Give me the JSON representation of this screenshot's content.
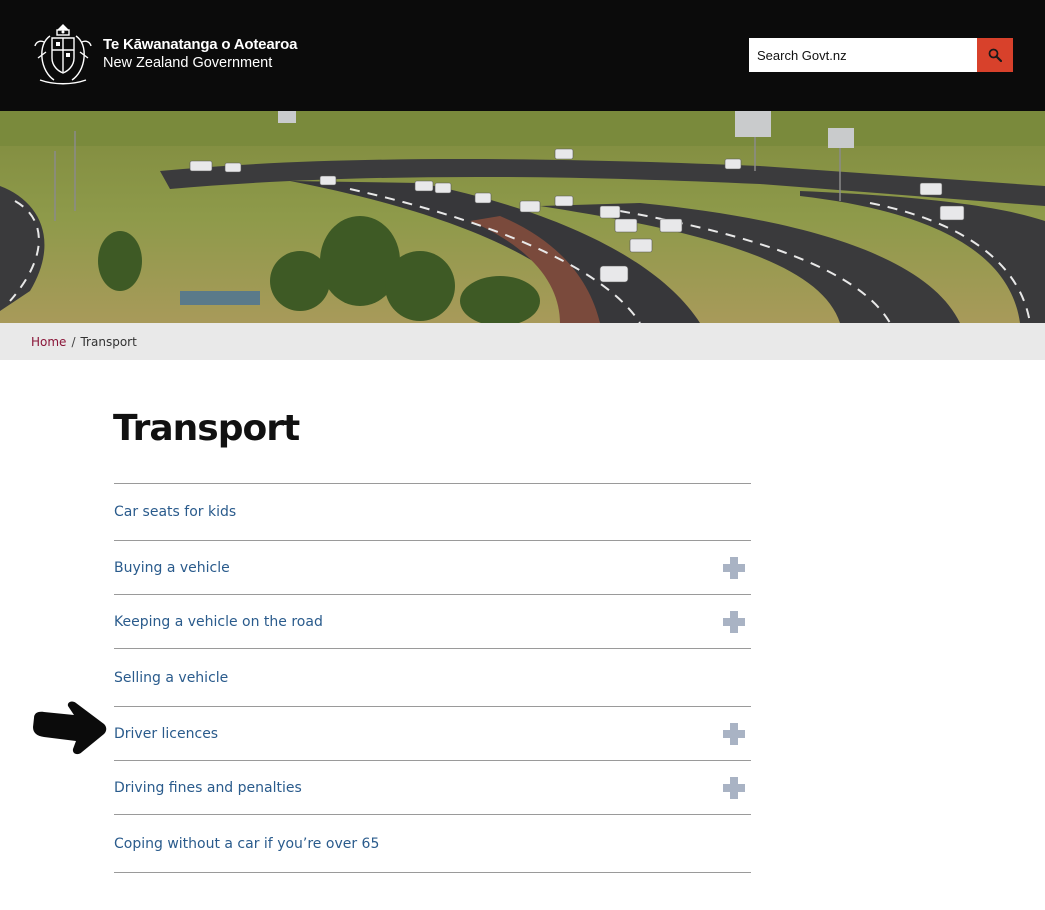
{
  "header": {
    "logo_line1": "Te Kāwanatanga o Aotearoa",
    "logo_line2": "New Zealand Government",
    "crest_icon": "nz-coat-of-arms-icon",
    "search": {
      "placeholder": "Search Govt.nz",
      "button_icon": "search-icon"
    },
    "colors": {
      "background": "#0b0b0b",
      "search_button": "#d8412b"
    }
  },
  "hero": {
    "icon": "motorway-photo"
  },
  "breadcrumb": {
    "home": "Home",
    "separator": "/",
    "current": "Transport"
  },
  "page": {
    "title": "Transport"
  },
  "topics": [
    {
      "label": "Car seats for kids",
      "expandable": false
    },
    {
      "label": "Buying a vehicle",
      "expandable": true
    },
    {
      "label": "Keeping a vehicle on the road",
      "expandable": true
    },
    {
      "label": "Selling a vehicle",
      "expandable": false
    },
    {
      "label": "Driver licences",
      "expandable": true
    },
    {
      "label": "Driving fines and penalties",
      "expandable": true
    },
    {
      "label": "Coping without a car if you’re over 65",
      "expandable": false
    }
  ],
  "annotation": {
    "icon": "pointing-arrow-icon"
  },
  "colors": {
    "link": "#2a5b8c",
    "breadcrumb_home": "#8a1538",
    "plus": "#a9b3c4"
  }
}
